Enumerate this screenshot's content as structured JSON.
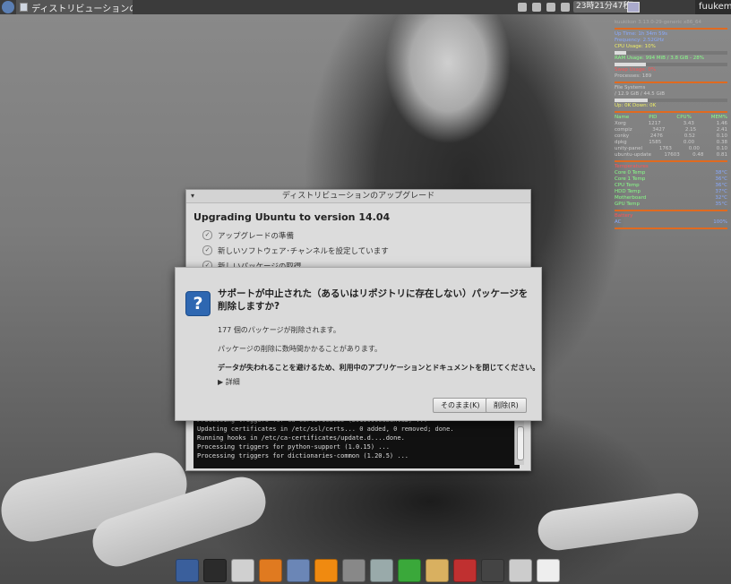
{
  "top_panel": {
    "task_title": "ディストリビューションのアップ…",
    "clock": "23時21分47秒",
    "user": "fuukemn"
  },
  "conky": {
    "header": "kuukikon 3.13.0-29-generic x86_64",
    "lines": [
      "Up Time: 1h 34m 59s",
      "Frequency: 2.52GHz",
      "CPU Usage: 10%",
      "RAM Usage: 994 MiB / 3.8 GiB - 28%",
      "Swap Usage: 0%",
      "Processes: 189"
    ],
    "fs_label": "File Systems",
    "fs_line": "/ 12.9 GiB / 44.5 GiB",
    "net_line": "Up: 0K  Down: 0K",
    "proc_header": [
      "Name",
      "PID",
      "CPU%",
      "MEM%"
    ],
    "procs": [
      [
        "Xorg",
        "1217",
        "3.43",
        "1.46"
      ],
      [
        "compiz",
        "3427",
        "2.15",
        "2.41"
      ],
      [
        "conky",
        "2476",
        "0.52",
        "0.10"
      ],
      [
        "dpkg",
        "1585",
        "0.00",
        "0.38"
      ],
      [
        "unity-panel",
        "1763",
        "0.00",
        "0.10"
      ],
      [
        "ubuntu-update",
        "17603",
        "0.48",
        "0.81"
      ]
    ],
    "temp_label": "Temperatures",
    "temps": [
      [
        "Core 0 Temp",
        "38°C"
      ],
      [
        "Core 1 Temp",
        "36°C"
      ],
      [
        "CPU Temp",
        "36°C"
      ],
      [
        "HDD Temp",
        "37°C"
      ],
      [
        "Motherboard",
        "32°C"
      ],
      [
        "GPU Temp",
        "35°C"
      ]
    ],
    "battery_label": "Battery",
    "battery_value": "AC",
    "battery_pct": "100%"
  },
  "upgrade_window": {
    "title": "ディストリビューションのアップグレード",
    "heading": "Upgrading Ubuntu to version 14.04",
    "steps": [
      "アップグレードの準備",
      "新しいソフトウェア･チャンネルを設定しています",
      "新しいパッケージの取得"
    ],
    "terminal": [
      "Processing triggers for ca-certificates (20130906ubuntu2) ...",
      "Updating certificates in /etc/ssl/certs... 0 added, 0 removed; done.",
      "Running hooks in /etc/ca-certificates/update.d....done.",
      "Processing triggers for python-support (1.0.15) ...",
      "Processing triggers for dictionaries-common (1.20.5) ..."
    ]
  },
  "dialog": {
    "title": "サポートが中止された（あるいはリポジトリに存在しない）パッケージを削除しますか?",
    "line1": "177 個のパッケージが削除されます。",
    "line2": "パッケージの削除に数時間かかることがあります。",
    "warning": "データが失われることを避けるため、利用中のアプリケーションとドキュメントを閉じてください。",
    "details": "▶ 詳細",
    "keep_label": "そのまま(K)",
    "remove_label": "削除(R)"
  },
  "dock": {
    "icons": [
      "desktop-icon",
      "terminal-icon",
      "files-icon",
      "firefox-icon",
      "mail-icon",
      "vlc-icon",
      "mixer-icon",
      "search-icon",
      "hashtag-icon",
      "folder-icon",
      "font-icon",
      "camera-icon",
      "trash-icon",
      "logout-icon"
    ]
  }
}
